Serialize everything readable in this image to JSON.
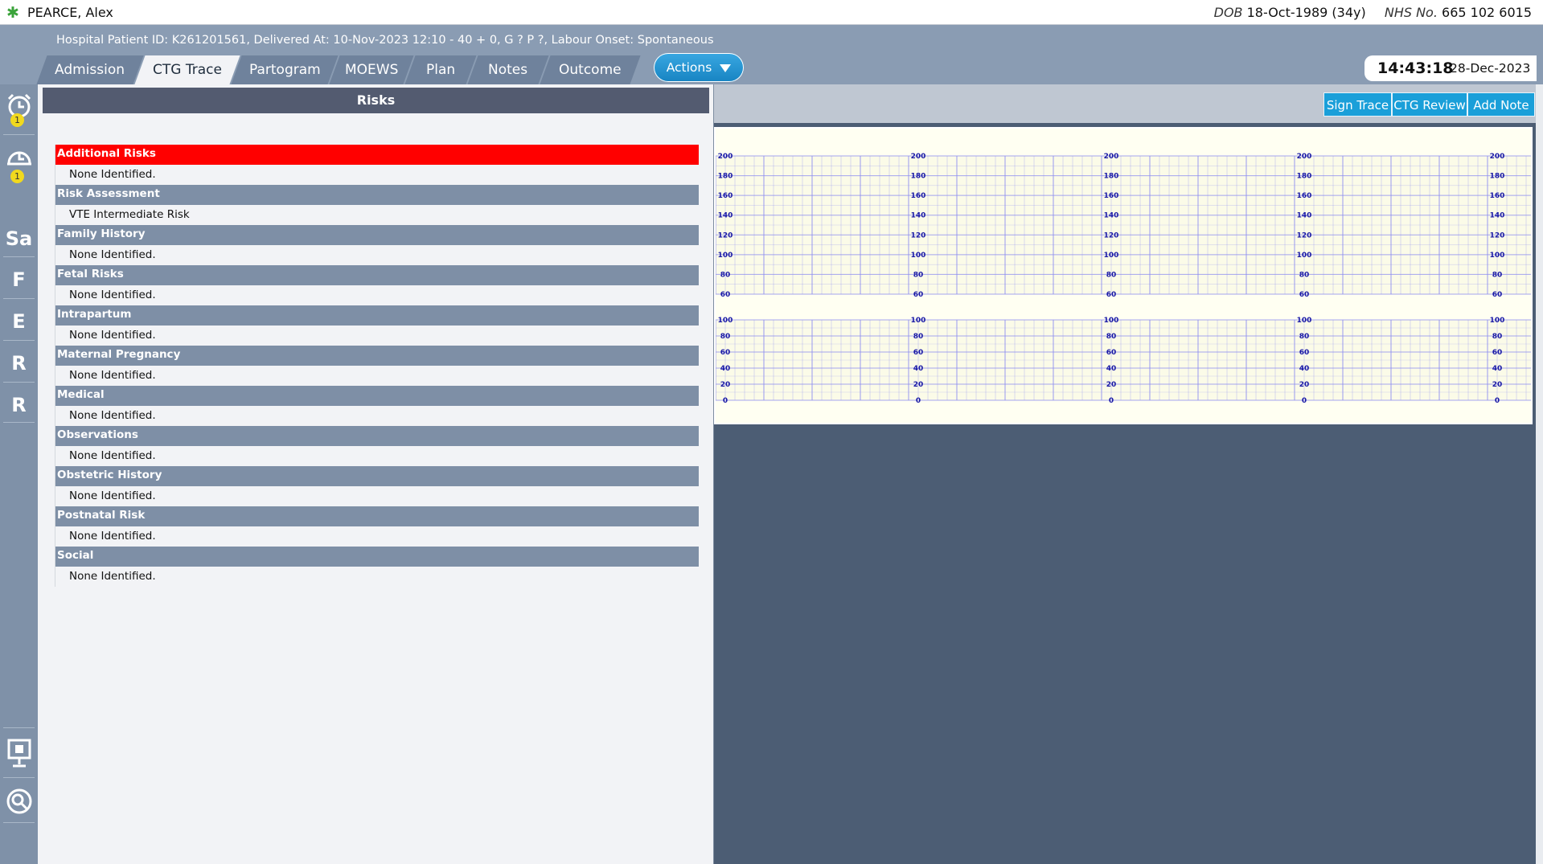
{
  "topbar": {
    "patient_name": "PEARCE, Alex",
    "dob_label": "DOB",
    "dob_value": "18-Oct-1989 (34y)",
    "nhs_label": "NHS No.",
    "nhs_value": "665 102 6015"
  },
  "header": {
    "patient_info": "Hospital Patient ID: K261201561, Delivered At: 10-Nov-2023 12:10 - 40 + 0, G ? P ?,    Labour Onset: Spontaneous",
    "tabs": [
      {
        "label": "Admission"
      },
      {
        "label": "CTG Trace",
        "active": true
      },
      {
        "label": "Partogram"
      },
      {
        "label": "MOEWS"
      },
      {
        "label": "Plan"
      },
      {
        "label": "Notes"
      },
      {
        "label": "Outcome"
      }
    ],
    "actions_label": "Actions",
    "clock_time": "14:43:18",
    "clock_date": "28-Dec-2023"
  },
  "rail": {
    "alarm_badge": "1",
    "alarm_badge_2": "1",
    "letters": [
      "Sa",
      "F",
      "E",
      "R",
      "R"
    ],
    "icons": [
      "alarm-clock-icon",
      "snooze-alarm-icon",
      "monitor-icon",
      "search-icon"
    ]
  },
  "risks": {
    "title": "Risks",
    "sections": [
      {
        "heading": "Additional Risks",
        "value": "None Identified.",
        "alert": true
      },
      {
        "heading": "Risk Assessment",
        "value": "VTE Intermediate Risk"
      },
      {
        "heading": "Family History",
        "value": "None Identified."
      },
      {
        "heading": "Fetal Risks",
        "value": "None Identified."
      },
      {
        "heading": "Intrapartum",
        "value": "None Identified."
      },
      {
        "heading": "Maternal Pregnancy",
        "value": "None Identified."
      },
      {
        "heading": "Medical",
        "value": "None Identified."
      },
      {
        "heading": "Observations",
        "value": "None Identified."
      },
      {
        "heading": "Obstetric History",
        "value": "None Identified."
      },
      {
        "heading": "Postnatal Risk",
        "value": "None Identified."
      },
      {
        "heading": "Social",
        "value": "None Identified."
      }
    ]
  },
  "ctg": {
    "buttons": [
      "Sign Trace",
      "CTG Review",
      "Add Note"
    ],
    "fhr_ticks": [
      "200",
      "180",
      "160",
      "140",
      "120",
      "100",
      "80",
      "60"
    ],
    "toco_ticks": [
      "100",
      "80",
      "60",
      "40",
      "20",
      "0"
    ],
    "grid_color": "#8f8ff0",
    "label_color": "#1a1aa6"
  }
}
